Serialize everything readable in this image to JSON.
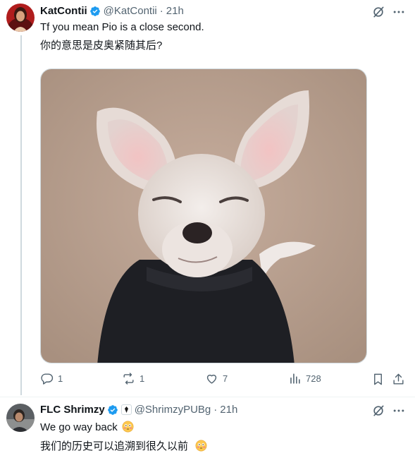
{
  "tweet1": {
    "display_name": "KatContii",
    "handle": "@KatContii",
    "time": "21h",
    "text_line1": "Tf you mean Pio is a close second.",
    "text_line2": "你的意思是皮奥紧随其后?",
    "stats": {
      "replies": "1",
      "reposts": "1",
      "likes": "7",
      "views": "728"
    }
  },
  "tweet2": {
    "display_name": "FLC Shrimzy",
    "handle": "@ShrimzyPUBg",
    "time": "21h",
    "text_line1": "We go way back",
    "text_line2": "我们的历史可以追溯到很久以前"
  },
  "colors": {
    "verified": "#1d9bf0",
    "muted": "#536471",
    "text": "#0f1419",
    "thread_line": "#cfd9de"
  }
}
